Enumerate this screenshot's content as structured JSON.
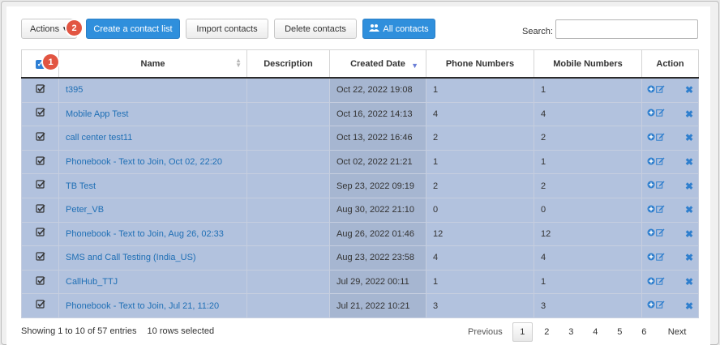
{
  "toolbar": {
    "actions_label": "Actions",
    "create_label": "Create a contact list",
    "import_label": "Import contacts",
    "delete_label": "Delete contacts",
    "all_label": "All contacts",
    "search_label": "Search:",
    "search_value": "",
    "badge_actions": "2",
    "badge_select": "1"
  },
  "table": {
    "headers": [
      "Name",
      "Description",
      "Created Date",
      "Phone Numbers",
      "Mobile Numbers",
      "Action"
    ],
    "rows": [
      {
        "name": "t395",
        "description": "",
        "created": "Oct 22, 2022 19:08",
        "phone": "1",
        "mobile": "1"
      },
      {
        "name": "Mobile App Test",
        "description": "",
        "created": "Oct 16, 2022 14:13",
        "phone": "4",
        "mobile": "4"
      },
      {
        "name": "call center test11",
        "description": "",
        "created": "Oct 13, 2022 16:46",
        "phone": "2",
        "mobile": "2"
      },
      {
        "name": "Phonebook - Text to Join, Oct 02, 22:20",
        "description": "",
        "created": "Oct 02, 2022 21:21",
        "phone": "1",
        "mobile": "1"
      },
      {
        "name": "TB Test",
        "description": "",
        "created": "Sep 23, 2022 09:19",
        "phone": "2",
        "mobile": "2"
      },
      {
        "name": "Peter_VB",
        "description": "",
        "created": "Aug 30, 2022 21:10",
        "phone": "0",
        "mobile": "0"
      },
      {
        "name": "Phonebook - Text to Join, Aug 26, 02:33",
        "description": "",
        "created": "Aug 26, 2022 01:46",
        "phone": "12",
        "mobile": "12"
      },
      {
        "name": "SMS and Call Testing (India_US)",
        "description": "",
        "created": "Aug 23, 2022 23:58",
        "phone": "4",
        "mobile": "4"
      },
      {
        "name": "CallHub_TTJ",
        "description": "",
        "created": "Jul 29, 2022 00:11",
        "phone": "1",
        "mobile": "1"
      },
      {
        "name": "Phonebook - Text to Join, Jul 21, 11:20",
        "description": "",
        "created": "Jul 21, 2022 10:21",
        "phone": "3",
        "mobile": "3"
      }
    ]
  },
  "footer": {
    "entries_info": "Showing 1 to 10 of 57 entries",
    "selected_info": "10 rows selected",
    "prev": "Previous",
    "pages": [
      "1",
      "2",
      "3",
      "4",
      "5",
      "6"
    ],
    "next": "Next",
    "current_page": "1"
  },
  "colors": {
    "primary": "#2f8fdc",
    "row_selected": "#b2c2de",
    "badge": "#e25542",
    "link": "#1f6fb5"
  },
  "icons": [
    "caret-down-icon",
    "users-icon",
    "checkbox-checked-icon",
    "add-circle-icon",
    "edit-icon",
    "delete-x-icon",
    "sort-icon",
    "sort-desc-icon"
  ]
}
